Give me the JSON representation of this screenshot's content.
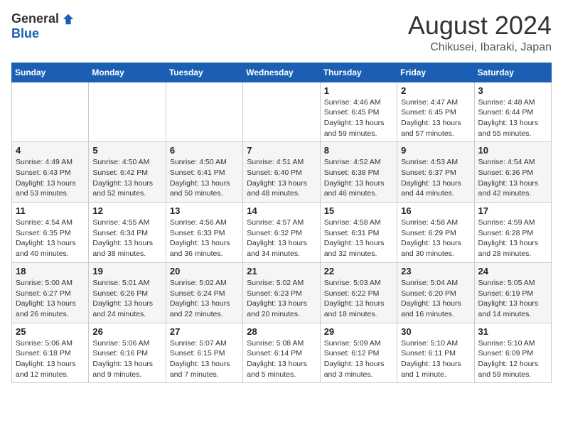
{
  "logo": {
    "general": "General",
    "blue": "Blue"
  },
  "title": {
    "month_year": "August 2024",
    "location": "Chikusei, Ibaraki, Japan"
  },
  "weekdays": [
    "Sunday",
    "Monday",
    "Tuesday",
    "Wednesday",
    "Thursday",
    "Friday",
    "Saturday"
  ],
  "weeks": [
    [
      {
        "day": "",
        "info": ""
      },
      {
        "day": "",
        "info": ""
      },
      {
        "day": "",
        "info": ""
      },
      {
        "day": "",
        "info": ""
      },
      {
        "day": "1",
        "info": "Sunrise: 4:46 AM\nSunset: 6:45 PM\nDaylight: 13 hours\nand 59 minutes."
      },
      {
        "day": "2",
        "info": "Sunrise: 4:47 AM\nSunset: 6:45 PM\nDaylight: 13 hours\nand 57 minutes."
      },
      {
        "day": "3",
        "info": "Sunrise: 4:48 AM\nSunset: 6:44 PM\nDaylight: 13 hours\nand 55 minutes."
      }
    ],
    [
      {
        "day": "4",
        "info": "Sunrise: 4:49 AM\nSunset: 6:43 PM\nDaylight: 13 hours\nand 53 minutes."
      },
      {
        "day": "5",
        "info": "Sunrise: 4:50 AM\nSunset: 6:42 PM\nDaylight: 13 hours\nand 52 minutes."
      },
      {
        "day": "6",
        "info": "Sunrise: 4:50 AM\nSunset: 6:41 PM\nDaylight: 13 hours\nand 50 minutes."
      },
      {
        "day": "7",
        "info": "Sunrise: 4:51 AM\nSunset: 6:40 PM\nDaylight: 13 hours\nand 48 minutes."
      },
      {
        "day": "8",
        "info": "Sunrise: 4:52 AM\nSunset: 6:38 PM\nDaylight: 13 hours\nand 46 minutes."
      },
      {
        "day": "9",
        "info": "Sunrise: 4:53 AM\nSunset: 6:37 PM\nDaylight: 13 hours\nand 44 minutes."
      },
      {
        "day": "10",
        "info": "Sunrise: 4:54 AM\nSunset: 6:36 PM\nDaylight: 13 hours\nand 42 minutes."
      }
    ],
    [
      {
        "day": "11",
        "info": "Sunrise: 4:54 AM\nSunset: 6:35 PM\nDaylight: 13 hours\nand 40 minutes."
      },
      {
        "day": "12",
        "info": "Sunrise: 4:55 AM\nSunset: 6:34 PM\nDaylight: 13 hours\nand 38 minutes."
      },
      {
        "day": "13",
        "info": "Sunrise: 4:56 AM\nSunset: 6:33 PM\nDaylight: 13 hours\nand 36 minutes."
      },
      {
        "day": "14",
        "info": "Sunrise: 4:57 AM\nSunset: 6:32 PM\nDaylight: 13 hours\nand 34 minutes."
      },
      {
        "day": "15",
        "info": "Sunrise: 4:58 AM\nSunset: 6:31 PM\nDaylight: 13 hours\nand 32 minutes."
      },
      {
        "day": "16",
        "info": "Sunrise: 4:58 AM\nSunset: 6:29 PM\nDaylight: 13 hours\nand 30 minutes."
      },
      {
        "day": "17",
        "info": "Sunrise: 4:59 AM\nSunset: 6:28 PM\nDaylight: 13 hours\nand 28 minutes."
      }
    ],
    [
      {
        "day": "18",
        "info": "Sunrise: 5:00 AM\nSunset: 6:27 PM\nDaylight: 13 hours\nand 26 minutes."
      },
      {
        "day": "19",
        "info": "Sunrise: 5:01 AM\nSunset: 6:26 PM\nDaylight: 13 hours\nand 24 minutes."
      },
      {
        "day": "20",
        "info": "Sunrise: 5:02 AM\nSunset: 6:24 PM\nDaylight: 13 hours\nand 22 minutes."
      },
      {
        "day": "21",
        "info": "Sunrise: 5:02 AM\nSunset: 6:23 PM\nDaylight: 13 hours\nand 20 minutes."
      },
      {
        "day": "22",
        "info": "Sunrise: 5:03 AM\nSunset: 6:22 PM\nDaylight: 13 hours\nand 18 minutes."
      },
      {
        "day": "23",
        "info": "Sunrise: 5:04 AM\nSunset: 6:20 PM\nDaylight: 13 hours\nand 16 minutes."
      },
      {
        "day": "24",
        "info": "Sunrise: 5:05 AM\nSunset: 6:19 PM\nDaylight: 13 hours\nand 14 minutes."
      }
    ],
    [
      {
        "day": "25",
        "info": "Sunrise: 5:06 AM\nSunset: 6:18 PM\nDaylight: 13 hours\nand 12 minutes."
      },
      {
        "day": "26",
        "info": "Sunrise: 5:06 AM\nSunset: 6:16 PM\nDaylight: 13 hours\nand 9 minutes."
      },
      {
        "day": "27",
        "info": "Sunrise: 5:07 AM\nSunset: 6:15 PM\nDaylight: 13 hours\nand 7 minutes."
      },
      {
        "day": "28",
        "info": "Sunrise: 5:08 AM\nSunset: 6:14 PM\nDaylight: 13 hours\nand 5 minutes."
      },
      {
        "day": "29",
        "info": "Sunrise: 5:09 AM\nSunset: 6:12 PM\nDaylight: 13 hours\nand 3 minutes."
      },
      {
        "day": "30",
        "info": "Sunrise: 5:10 AM\nSunset: 6:11 PM\nDaylight: 13 hours\nand 1 minute."
      },
      {
        "day": "31",
        "info": "Sunrise: 5:10 AM\nSunset: 6:09 PM\nDaylight: 12 hours\nand 59 minutes."
      }
    ]
  ]
}
